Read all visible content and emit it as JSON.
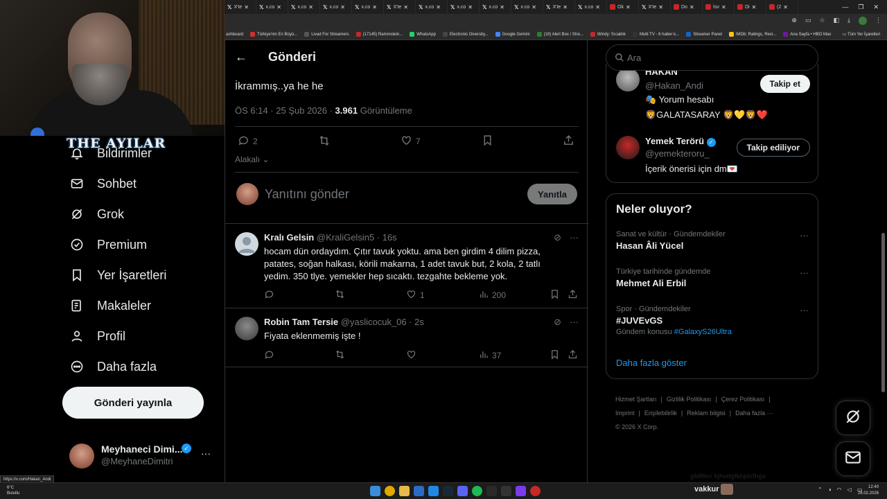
{
  "browser": {
    "tabs": [
      "X'te",
      "x.co",
      "x.co",
      "x.co",
      "x.co",
      "X'te",
      "x.co",
      "x.co",
      "x.co",
      "x.co",
      "X'te",
      "x.co",
      "Ok",
      "X'te",
      "Do",
      "İsv",
      "Di",
      "(2"
    ],
    "bookmarks": [
      "ashboard",
      "Türkiye'nin En Büyü...",
      "Livad For Streamers",
      "(17145) Rammstein...",
      "WhatsApp",
      "Electronic Diversity...",
      "Google Gemini",
      "(19) Alert Box / Stre...",
      "Windy: Sıcaklık",
      "Multi TV - 6 haber k...",
      "Streamer Panel",
      "IMDb: Ratings, Revi...",
      "Ana Sayfa • HBO Max"
    ],
    "bookmarks_right": "Tüm Yer İşaretleri",
    "status_url": "https://x.com/Hakan_Andi"
  },
  "stream": {
    "logo_text": "THE AYILAR"
  },
  "nav": {
    "items": [
      {
        "label": "Bildirimler",
        "icon": "bell-icon"
      },
      {
        "label": "Sohbet",
        "icon": "mail-icon"
      },
      {
        "label": "Grok",
        "icon": "grok-icon"
      },
      {
        "label": "Premium",
        "icon": "verified-badge-icon"
      },
      {
        "label": "Yer İşaretleri",
        "icon": "bookmark-icon"
      },
      {
        "label": "Makaleler",
        "icon": "article-icon"
      },
      {
        "label": "Profil",
        "icon": "person-icon"
      },
      {
        "label": "Daha fazla",
        "icon": "more-circle-icon"
      }
    ],
    "post_button": "Gönderi yayınla"
  },
  "account": {
    "name": "Meyhaneci Dimi...",
    "handle": "@MeyhaneDimitri"
  },
  "main": {
    "title": "Gönderi",
    "post_text": "İkrammış..ya he he",
    "meta_time": "ÖS 6:14 · 25 Şub 2026 · ",
    "meta_views": "3.961",
    "meta_views_label": " Görüntüleme",
    "replies": "2",
    "likes": "7",
    "related": "Alakalı",
    "reply_placeholder": "Yanıtını gönder",
    "reply_button": "Yanıtla"
  },
  "tweets": [
    {
      "name": "Kralı Gelsin",
      "handle": "@KraliGelsin5 · 16s",
      "text": "hocam dün ordaydım. Çıtır tavuk yoktu. ama ben girdim 4 dilim pizza, patates, soğan halkası, körili makarna, 1 adet tavuk but, 2 kola, 2 tatlı yedim. 350 tlye. yemekler hep sıcaktı. tezgahte bekleme yok.",
      "likes": "1",
      "views": "200"
    },
    {
      "name": "Robin Tam Tersie",
      "handle": "@yaslicocuk_06 · 2s",
      "text": "Fiyata eklenmemiş işte !",
      "likes": "",
      "views": "37"
    }
  ],
  "right": {
    "search_placeholder": "Ara",
    "who": [
      {
        "name": "HAKAN",
        "handle": "@Hakan_Andi",
        "bio1": "🎭 Yorum hesabı",
        "bio2": "🦁GALATASARAY 🦁💛🦁❤️",
        "button": "Takip et"
      },
      {
        "name": "Yemek Terörü",
        "handle": "@yemekteroru_",
        "bio1": "İçerik önerisi için dm💌",
        "button": "Takip ediliyor"
      }
    ],
    "trends_title": "Neler oluyor?",
    "trends": [
      {
        "context": "Sanat ve kültür · Gündemdekiler",
        "title": "Hasan Âli Yücel"
      },
      {
        "context": "Türkiye tarihinde gündemde",
        "title": "Mehmet Ali Erbil"
      },
      {
        "context": "Spor · Gündemdekiler",
        "title": "#JUVEvGS",
        "sub_label": "Gündem konusu ",
        "sub_link": "#GalaxyS26Ultra"
      }
    ],
    "show_more": "Daha fazla göster",
    "footer": [
      "Hizmet Şartları",
      "|",
      "Gizlilik Politikası",
      "|",
      "Çerez Politikası",
      "|",
      "Imprint",
      "|",
      "Erişilebilirlik",
      "|",
      "Reklam bilgisi",
      "|",
      "Daha fazla ···",
      "© 2026 X Corp."
    ]
  },
  "taskbar": {
    "weather_temp": "6°C",
    "weather_desc": "Bulutlu",
    "time": "12:40",
    "date": "26.02.2026",
    "overlay_user": "vakkur",
    "overlay_faint": "gfdftkrr kjhvdgfkhjdsfhgs"
  },
  "colors": {
    "accent": "#1d9bf0",
    "background": "#000000",
    "text": "#e7e9ea",
    "muted": "#71767b",
    "border": "#2f3336"
  }
}
